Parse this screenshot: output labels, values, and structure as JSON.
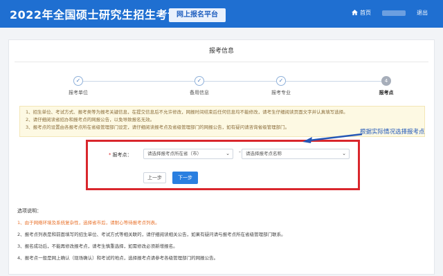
{
  "header": {
    "brand": "2022年全国硕士研究生招生考试",
    "platform_label": "网上报名平台",
    "home_label": "首页",
    "logout_label": "退出"
  },
  "page_title": "报考信息",
  "steps": [
    {
      "label": "报考单位",
      "marker": "✓"
    },
    {
      "label": "备用信息",
      "marker": "✓"
    },
    {
      "label": "报考专业",
      "marker": "✓"
    },
    {
      "label": "报考点",
      "marker": "4"
    }
  ],
  "notice": [
    "1、招生单位、考试方式、报考类等为报考关键信息，在提交信息后不允许修改，网报时间结束后任何信息均不能修改，请考生仔细阅读页面文字并认真填写选择。",
    "2、请仔细阅读省招办和报考点的网报公告，以免导致报名无效。",
    "3、报考点的设置由各报考点所在省级管理部门设定，请仔细阅读报考点及省级管理部门的网报公告，如有疑问请咨询省级管理部门。"
  ],
  "form": {
    "field_label": "报考点：",
    "required_mark": "*",
    "province_select": "请选择报考点所在省（市）",
    "site_select": "请选择报考点名称",
    "separator": "-",
    "prev_button": "上一步",
    "next_button": "下一步"
  },
  "annotation": "根据实际情况选择报考点",
  "explanations": {
    "title": "选项说明：",
    "items": [
      "1、由于网络环境及系统复杂性，选择省市后，请耐心等待报考点列表。",
      "2、报考点列表是和前面填写的招生单位、考试方式等相关联的，请仔细阅读相关公告，如果有疑问请与报考点所在省级管理部门联系。",
      "3、报名成功后，不能再修改报考点，请考生慎重选择，如需修改必须新增报名。",
      "4、报考点一般是网上确认（现场确认）和考试的地点，选择报考点请参考各级管理部门的网报公告。"
    ]
  },
  "colors": {
    "header_bg": "#1f6fd1",
    "primary_button": "#2a7fe0",
    "highlight_border": "#d9262c",
    "warning_text": "#e8712a"
  }
}
